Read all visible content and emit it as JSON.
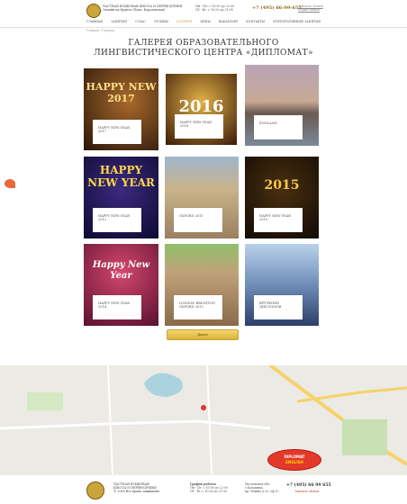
{
  "header": {
    "brand_lines": [
      "ЧАСТНАЯ ЯЗЫКОВАЯ ШКОЛА И ПЕРЕВОДЧИКИ",
      "Онлайн на Фрунзе (Павл. Королевская)"
    ],
    "schedule_lines": [
      "Пн - Пт: с 10:00 до 22:00",
      "Сб - Вс: с 10:00 до 21:00"
    ],
    "phone": "+7 (495) 66-99-655",
    "links": [
      "Заказать Звонок",
      "Форма записи"
    ]
  },
  "nav": {
    "items": [
      "ГЛАВНАЯ",
      "ЗАНЯТИЯ",
      "О НАС",
      "ОТЗЫВЫ",
      "ГАЛЕРЕЯ",
      "ЦЕНЫ",
      "ВАКАНСИИ",
      "КОНТАКТЫ",
      "КОРПОРАТИВНЫЕ ЗАНЯТИЯ"
    ],
    "active_index": 4
  },
  "breadcrumb": "Главная / Галерея",
  "page_title": "ГАЛЕРЕЯ ОБРАЗОВАТЕЛЬНОГО ЛИНГВИСТИЧЕСКОГО ЦЕНТРА «ДИПЛОМАТ»",
  "tiles": [
    {
      "caption": "HAPPY NEW YEAR 2017",
      "art": "HAPPY NEW 2017"
    },
    {
      "caption": "HAPPY NEW YEAR 2016",
      "art": "2016"
    },
    {
      "caption": "ENGLAND",
      "art": ""
    },
    {
      "caption": "HAPPY NEW YEAR 2012",
      "art": "HAPPY NEW YEAR"
    },
    {
      "caption": "OXFORD 2011",
      "art": ""
    },
    {
      "caption": "HAPPY NEW YEAR 2015",
      "art": "2015"
    },
    {
      "caption": "HAPPY NEW YEAR 2014",
      "art": "Happy New Year"
    },
    {
      "caption": "LONDON BRIGHTON OXFORD 2013",
      "art": ""
    },
    {
      "caption": "ВРУЧЕНИЕ ДИПЛОМОВ",
      "art": ""
    }
  ],
  "button_more": "Далее",
  "footer": {
    "brand_lines": [
      "ЧАСТНАЯ ЯЗЫКОВАЯ",
      "ШКОЛА И ПЕРЕВОДЧИКИ",
      "© 2018 Все права защищены"
    ],
    "schedule_title": "График работы",
    "schedule_lines": [
      "Пн - Пт: с 10:00 до 22:00",
      "Сб - Вс: с 10:00 до 21:00"
    ],
    "address_lines": [
      "Московская обл.",
      "г.Балашиха,",
      "пр.Ленина д.25, оф.12"
    ],
    "phone": "+7 (495) 66 99 655",
    "link": "Заказать звонок"
  },
  "badge": {
    "line1": "DIPLOMAT",
    "line2": "ENGLISH"
  }
}
